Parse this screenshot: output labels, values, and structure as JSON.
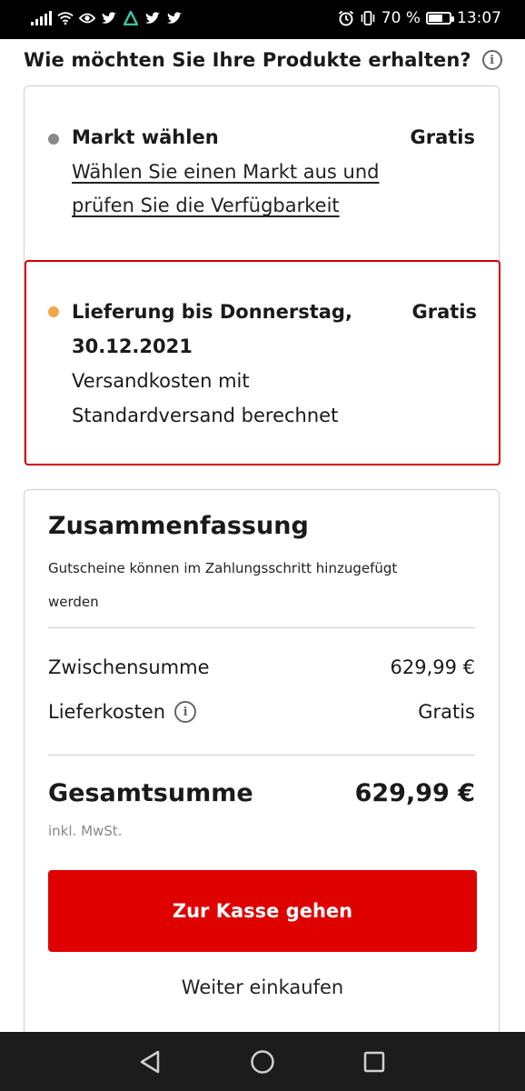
{
  "status_bar": {
    "battery_text": "70 %",
    "battery_level": 0.7,
    "time": "13:07",
    "left_icons": [
      "signal-icon",
      "wifi-icon",
      "eye-icon",
      "twitter-icon",
      "triangle-app-icon",
      "twitter-icon",
      "twitter-icon"
    ],
    "right_icons": [
      "alarm-icon",
      "vibrate-icon",
      "battery-icon"
    ]
  },
  "delivery": {
    "heading": "Wie möchten Sie Ihre Produkte erhalten?",
    "info_icon": "info-icon",
    "market_option": {
      "title": "Markt wählen",
      "price": "Gratis",
      "link_text": "Wählen Sie einen Markt aus und prüfen Sie die Verfügbarkeit",
      "dot_color": "#8a8a8a"
    },
    "shipping_option": {
      "title_line1": "Lieferung bis Donnerstag,",
      "title_line2": "30.12.2021",
      "price": "Gratis",
      "desc_line1": "Versandkosten mit",
      "desc_line2": "Standardversand berechnet",
      "dot_color": "#f5a54a",
      "border_color": "#d30000"
    }
  },
  "summary": {
    "title": "Zusammenfassung",
    "note": "Gutscheine können im Zahlungsschritt hinzugefügt werden",
    "subtotal_label": "Zwischensumme",
    "subtotal_value": "629,99 €",
    "shipping_label": "Lieferkosten",
    "shipping_value": "Gratis",
    "total_label": "Gesamtsumme",
    "total_value": "629,99 €",
    "vat_note": "inkl. MwSt.",
    "checkout_button": "Zur Kasse gehen",
    "continue_link": "Weiter einkaufen",
    "accent_color": "#df0000"
  },
  "nav": {
    "icons": [
      "back-icon",
      "home-icon",
      "recents-icon"
    ]
  }
}
